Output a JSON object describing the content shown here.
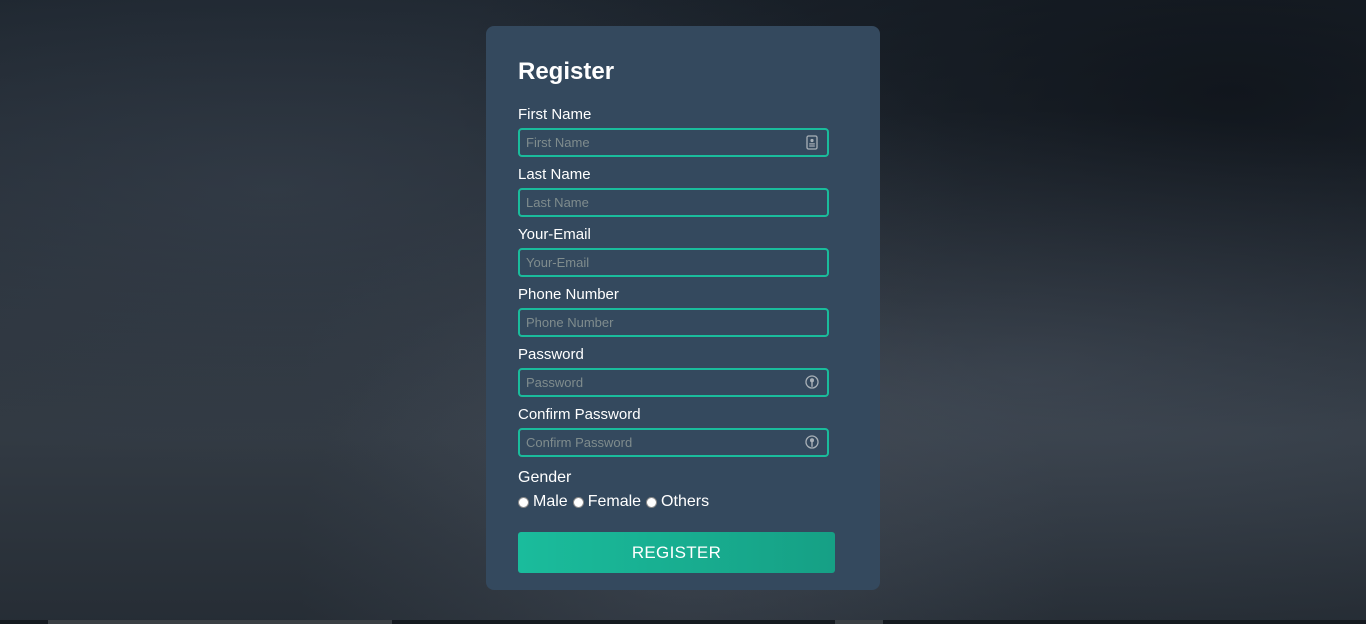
{
  "form": {
    "title": "Register",
    "fields": [
      {
        "label": "First Name",
        "placeholder": "First Name",
        "icon": "id-card-icon"
      },
      {
        "label": "Last Name",
        "placeholder": "Last Name",
        "icon": ""
      },
      {
        "label": "Your-Email",
        "placeholder": "Your-Email",
        "icon": ""
      },
      {
        "label": "Phone Number",
        "placeholder": "Phone Number",
        "icon": ""
      },
      {
        "label": "Password",
        "placeholder": "Password",
        "icon": "key-icon"
      },
      {
        "label": "Confirm Password",
        "placeholder": "Confirm Password",
        "icon": "key-icon"
      }
    ],
    "gender": {
      "label": "Gender",
      "options": [
        "Male",
        "Female",
        "Others"
      ]
    },
    "submit_label": "REGISTER"
  },
  "colors": {
    "card_bg": "#34495e",
    "accent": "#1abc9c",
    "accent_dark": "#16a085",
    "placeholder": "#7f8c8d"
  }
}
